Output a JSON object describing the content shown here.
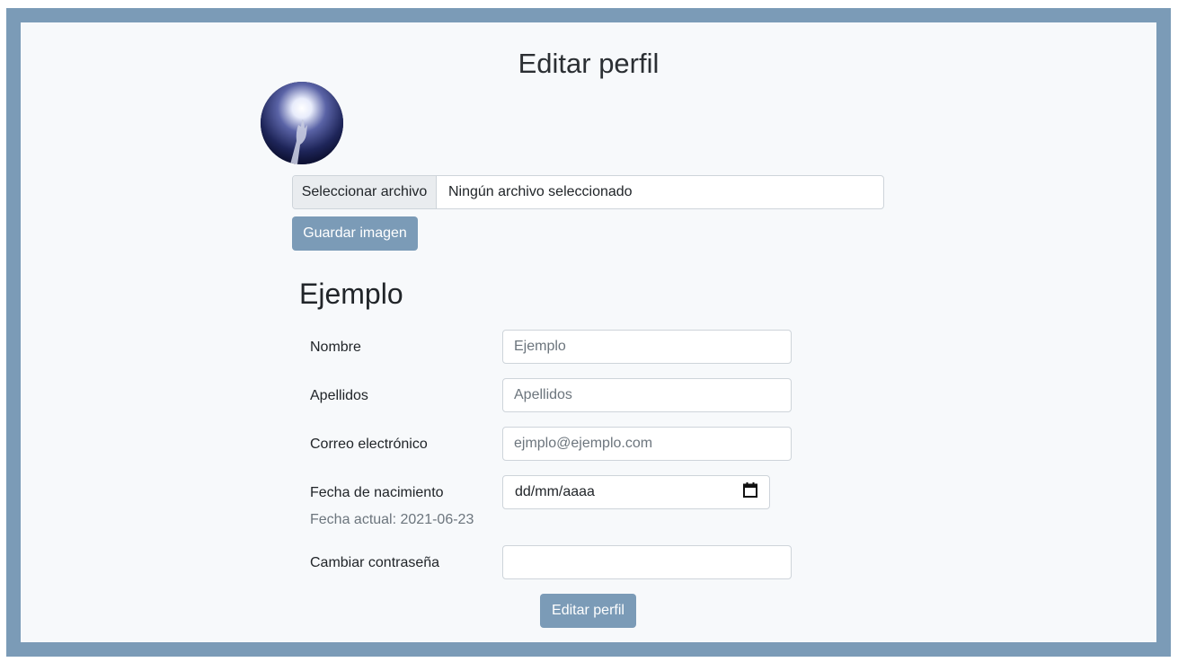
{
  "page": {
    "title": "Editar perfil",
    "accent_color": "#7b9bb7"
  },
  "avatar": {
    "icon": "profile-avatar"
  },
  "image_upload": {
    "choose_label": "Seleccionar archivo",
    "status_text": "Ningún archivo seleccionado",
    "save_label": "Guardar imagen"
  },
  "profile": {
    "username": "Ejemplo",
    "fields": {
      "name": {
        "label": "Nombre",
        "placeholder": "Ejemplo"
      },
      "surname": {
        "label": "Apellidos",
        "placeholder": "Apellidos"
      },
      "email": {
        "label": "Correo electrónico",
        "placeholder": "ejmplo@ejemplo.com"
      },
      "birthdate": {
        "label": "Fecha de nacimiento",
        "value": "dd/mm/aaaa",
        "current_hint": "Fecha actual: 2021-06-23",
        "icon": "calendar-icon"
      },
      "password": {
        "label": "Cambiar contraseña",
        "value": ""
      }
    },
    "submit_label": "Editar perfil"
  }
}
